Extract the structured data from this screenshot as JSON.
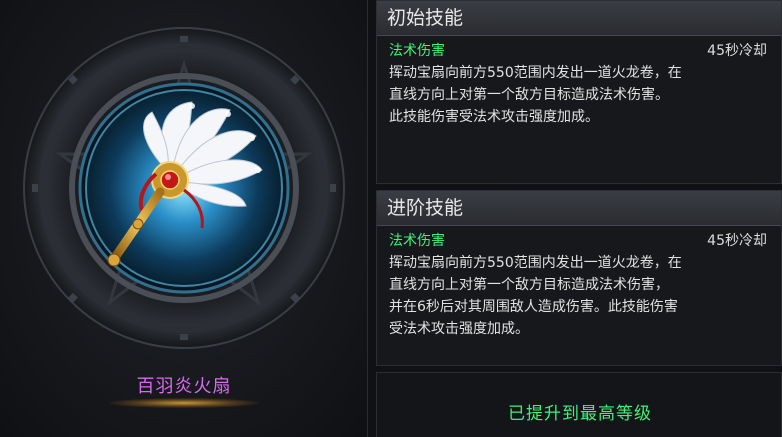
{
  "item": {
    "name": "百羽炎火扇",
    "icon": "feather-fan-icon"
  },
  "skills": [
    {
      "heading": "初始技能",
      "type": "法术伤害",
      "cooldown": "45秒冷却",
      "desc_lines": [
        "挥动宝扇向前方550范围内发出一道火龙卷，在",
        "直线方向上对第一个敌方目标造成法术伤害。",
        "此技能伤害受法术攻击强度加成。"
      ]
    },
    {
      "heading": "进阶技能",
      "type": "法术伤害",
      "cooldown": "45秒冷却",
      "desc_lines": [
        "挥动宝扇向前方550范围内发出一道火龙卷，在",
        "直线方向上对第一个敌方目标造成法术伤害，",
        "并在6秒后对其周围敌人造成伤害。此技能伤害",
        "受法术攻击强度加成。"
      ]
    }
  ],
  "status": {
    "max_level": "已提升到最高等级"
  },
  "colors": {
    "item_name": "#d86af0",
    "skill_type": "#3ff27a",
    "max_level": "#3ff27a"
  }
}
